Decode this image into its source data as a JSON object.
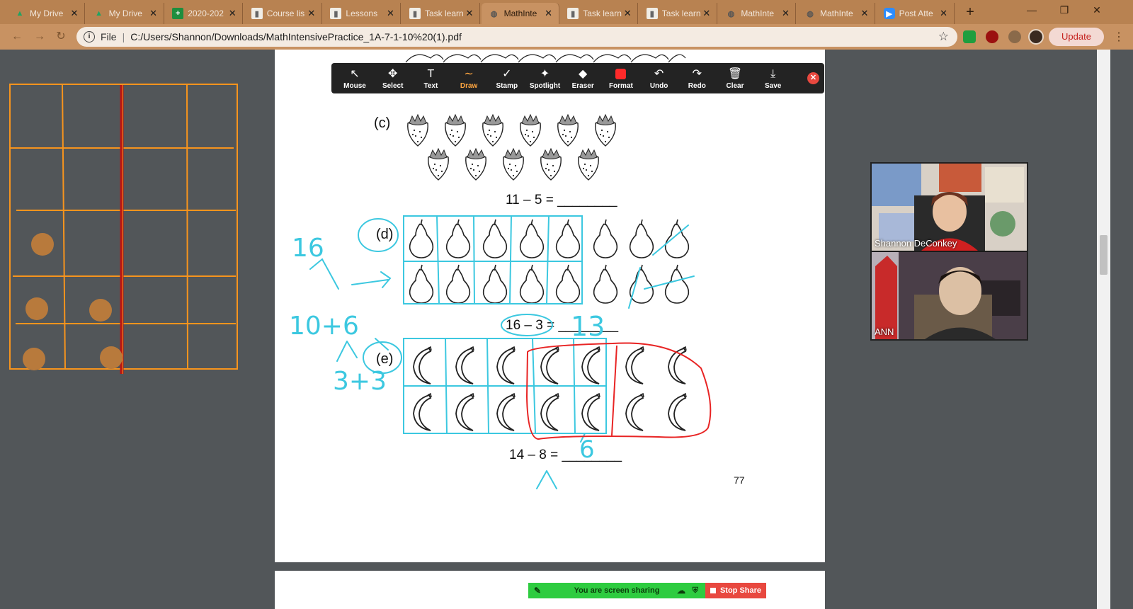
{
  "browser": {
    "tabs": [
      {
        "label": "My Drive",
        "icon": "drive-icon",
        "active": false
      },
      {
        "label": "My Drive",
        "icon": "drive-icon",
        "active": false
      },
      {
        "label": "2020-202",
        "icon": "sheets-icon",
        "active": false
      },
      {
        "label": "Course lis",
        "icon": "document-icon",
        "active": false
      },
      {
        "label": "Lessons",
        "icon": "document-icon",
        "active": false
      },
      {
        "label": "Task learn",
        "icon": "document-icon",
        "active": false
      },
      {
        "label": "MathInte",
        "icon": "globe-icon",
        "active": true
      },
      {
        "label": "Task learn",
        "icon": "document-icon",
        "active": false
      },
      {
        "label": "Task learn",
        "icon": "document-icon",
        "active": false
      },
      {
        "label": "MathInte",
        "icon": "globe-icon",
        "active": false
      },
      {
        "label": "MathInte",
        "icon": "globe-icon",
        "active": false
      },
      {
        "label": "Post Atte",
        "icon": "zoom-icon",
        "active": false
      }
    ],
    "address": {
      "scheme_label": "File",
      "url": "C:/Users/Shannon/Downloads/MathIntensivePractice_1A-7-1-10%20(1).pdf"
    },
    "update_label": "Update"
  },
  "zoom_toolbar": {
    "tools": [
      {
        "label": "Mouse",
        "icon": "cursor-icon",
        "glyph": "↖"
      },
      {
        "label": "Select",
        "icon": "move-icon",
        "glyph": "✥"
      },
      {
        "label": "Text",
        "icon": "text-icon",
        "glyph": "T"
      },
      {
        "label": "Draw",
        "icon": "draw-icon",
        "glyph": "∼"
      },
      {
        "label": "Stamp",
        "icon": "checkmark-icon",
        "glyph": "✓"
      },
      {
        "label": "Spotlight",
        "icon": "spotlight-icon",
        "glyph": "✦"
      },
      {
        "label": "Eraser",
        "icon": "eraser-icon",
        "glyph": "◆"
      },
      {
        "label": "Format",
        "icon": "color-swatch-icon",
        "glyph": ""
      },
      {
        "label": "Undo",
        "icon": "undo-icon",
        "glyph": "↶"
      },
      {
        "label": "Redo",
        "icon": "redo-icon",
        "glyph": "↷"
      },
      {
        "label": "Clear",
        "icon": "trash-icon",
        "glyph": "🗑"
      },
      {
        "label": "Save",
        "icon": "save-icon",
        "glyph": "⤓"
      }
    ],
    "active_tool": "Draw",
    "active_color": "#ffa640",
    "format_color": "#ff2a2a"
  },
  "worksheet": {
    "c_label": "(c)",
    "c_equation": "11 – 5 = ________",
    "d_label": "(d)",
    "d_equation": "16 – 3 = ________",
    "e_label": "(e)",
    "e_equation": "14 – 8 = ________",
    "page_number": "77"
  },
  "annotations": {
    "answer_d": "13",
    "answer_e": "6",
    "work_d_top": "16",
    "work_d_bottom": "10+6",
    "work_e": "3+3",
    "ink_color": "#3cc8e0",
    "highlight_color": "#e82424"
  },
  "videos": [
    {
      "name": "Shannon DeConkey"
    },
    {
      "name": "ANN"
    }
  ],
  "share_bar": {
    "status": "You are screen sharing",
    "stop_label": "Stop Share"
  }
}
